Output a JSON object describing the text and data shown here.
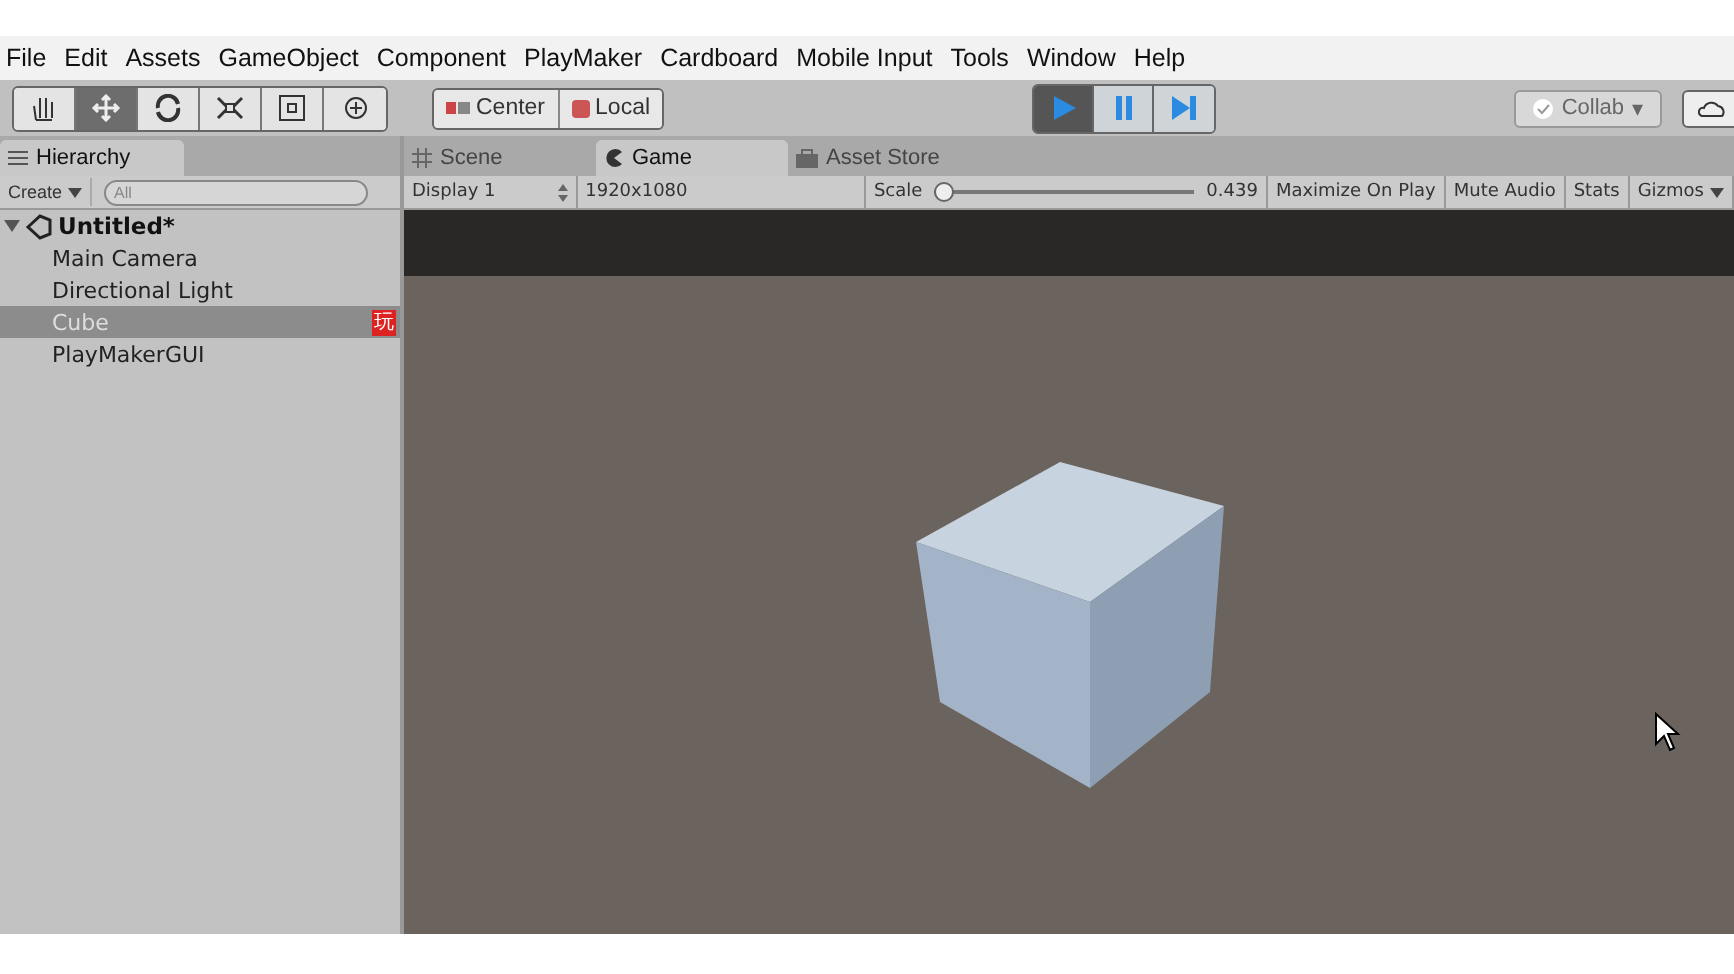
{
  "menu": [
    "File",
    "Edit",
    "Assets",
    "GameObject",
    "Component",
    "PlayMaker",
    "Cardboard",
    "Mobile Input",
    "Tools",
    "Window",
    "Help"
  ],
  "tools": [
    {
      "kind": "hand",
      "selected": false
    },
    {
      "kind": "move",
      "selected": true
    },
    {
      "kind": "rotate",
      "selected": false
    },
    {
      "kind": "scale",
      "selected": false
    },
    {
      "kind": "rect",
      "selected": false
    },
    {
      "kind": "transform",
      "selected": false
    }
  ],
  "pivot": [
    {
      "kind": "center",
      "label": "Center"
    },
    {
      "kind": "local",
      "label": "Local"
    }
  ],
  "playback": [
    {
      "kind": "play",
      "selected": true
    },
    {
      "kind": "pause",
      "selected": false
    },
    {
      "kind": "step",
      "selected": false
    }
  ],
  "collab": {
    "label": "Collab",
    "caret": "▾"
  },
  "hierarchy": {
    "tab": "Hierarchy",
    "create": "Create",
    "search_placeholder": "All",
    "scene": "Untitled*",
    "items": [
      {
        "name": "Main Camera",
        "selected": false
      },
      {
        "name": "Directional Light",
        "selected": false
      },
      {
        "name": "Cube",
        "selected": true,
        "badge": "玩"
      },
      {
        "name": "PlayMakerGUI",
        "selected": false
      }
    ]
  },
  "view_tabs": [
    {
      "kind": "scene",
      "label": "Scene",
      "selected": false
    },
    {
      "kind": "game",
      "label": "Game",
      "selected": true
    },
    {
      "kind": "store",
      "label": "Asset Store",
      "selected": false
    }
  ],
  "game_toolbar": {
    "display": "Display 1",
    "resolution": "1920x1080",
    "scale_label": "Scale",
    "scale": {
      "level": 0.0
    },
    "scale_value": "0.439",
    "buttons": [
      "Maximize On Play",
      "Mute Audio",
      "Stats"
    ],
    "gizmos": "Gizmos"
  }
}
